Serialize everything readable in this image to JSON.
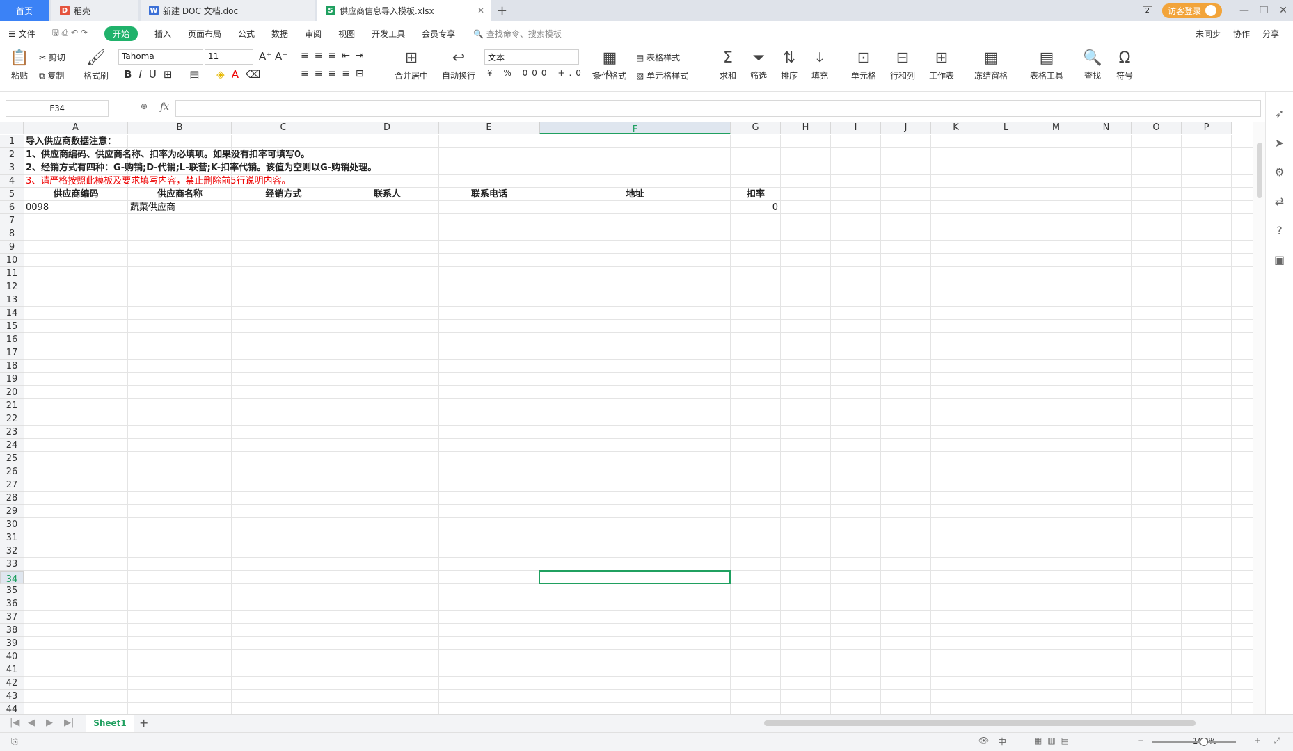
{
  "tabs": {
    "home": "首页",
    "t1": "稻壳",
    "t2": "新建 DOC 文档.doc",
    "t3": "供应商信息导入模板.xlsx"
  },
  "topright": {
    "badge": "2",
    "login": "访客登录"
  },
  "menu": {
    "file": "文件",
    "items": [
      "开始",
      "插入",
      "页面布局",
      "公式",
      "数据",
      "审阅",
      "视图",
      "开发工具",
      "会员专享"
    ],
    "search": "查找命令、搜索模板",
    "right": [
      "未同步",
      "协作",
      "分享"
    ]
  },
  "ribbon": {
    "paste": "粘贴",
    "cut": "剪切",
    "copy": "复制",
    "format_painter": "格式刷",
    "font": "Tahoma",
    "size": "11",
    "merge": "合并居中",
    "wrap": "自动换行",
    "numfmt": "文本",
    "cond": "条件格式",
    "table_style": "表格样式",
    "cell_style": "单元格样式",
    "sum": "求和",
    "filter": "筛选",
    "sort": "排序",
    "fill": "填充",
    "cell": "单元格",
    "rowcol": "行和列",
    "sheet": "工作表",
    "freeze": "冻结窗格",
    "tabletool": "表格工具",
    "find": "查找",
    "symbol": "符号"
  },
  "namebox": "F34",
  "fx": "fx",
  "columns": [
    "A",
    "B",
    "C",
    "D",
    "E",
    "F",
    "G",
    "H",
    "I",
    "J",
    "K",
    "L",
    "M",
    "N",
    "O",
    "P"
  ],
  "rows": [
    "1",
    "2",
    "3",
    "4",
    "5",
    "6",
    "7",
    "8",
    "9",
    "10",
    "11",
    "12",
    "13",
    "14",
    "15",
    "16",
    "17",
    "18",
    "19",
    "20",
    "21",
    "22",
    "23",
    "24",
    "25",
    "26",
    "27",
    "28",
    "29",
    "30",
    "31",
    "32",
    "33",
    "34",
    "35",
    "36",
    "37",
    "38",
    "39",
    "40",
    "41",
    "42",
    "43",
    "44"
  ],
  "cells": {
    "r1": "导入供应商数据注意：",
    "r2": "1、供应商编码、供应商名称、扣率为必填项。如果没有扣率可填写0。",
    "r3": "2、经销方式有四种：G-购销;D-代销;L-联营;K-扣率代销。该值为空则以G-购销处理。",
    "r4": "3、请严格按照此模板及要求填写内容，禁止删除前5行说明内容。",
    "headers": [
      "供应商编码",
      "供应商名称",
      "经销方式",
      "联系人",
      "联系电话",
      "地址",
      "扣率"
    ],
    "r6": [
      "0098",
      "蔬菜供应商",
      "0"
    ]
  },
  "sheet": {
    "name": "Sheet1"
  },
  "status": {
    "zoom": "100%"
  },
  "colors": {
    "accent": "#20a060",
    "home_tab": "#3b82f6",
    "warning_text": "#e00000"
  }
}
